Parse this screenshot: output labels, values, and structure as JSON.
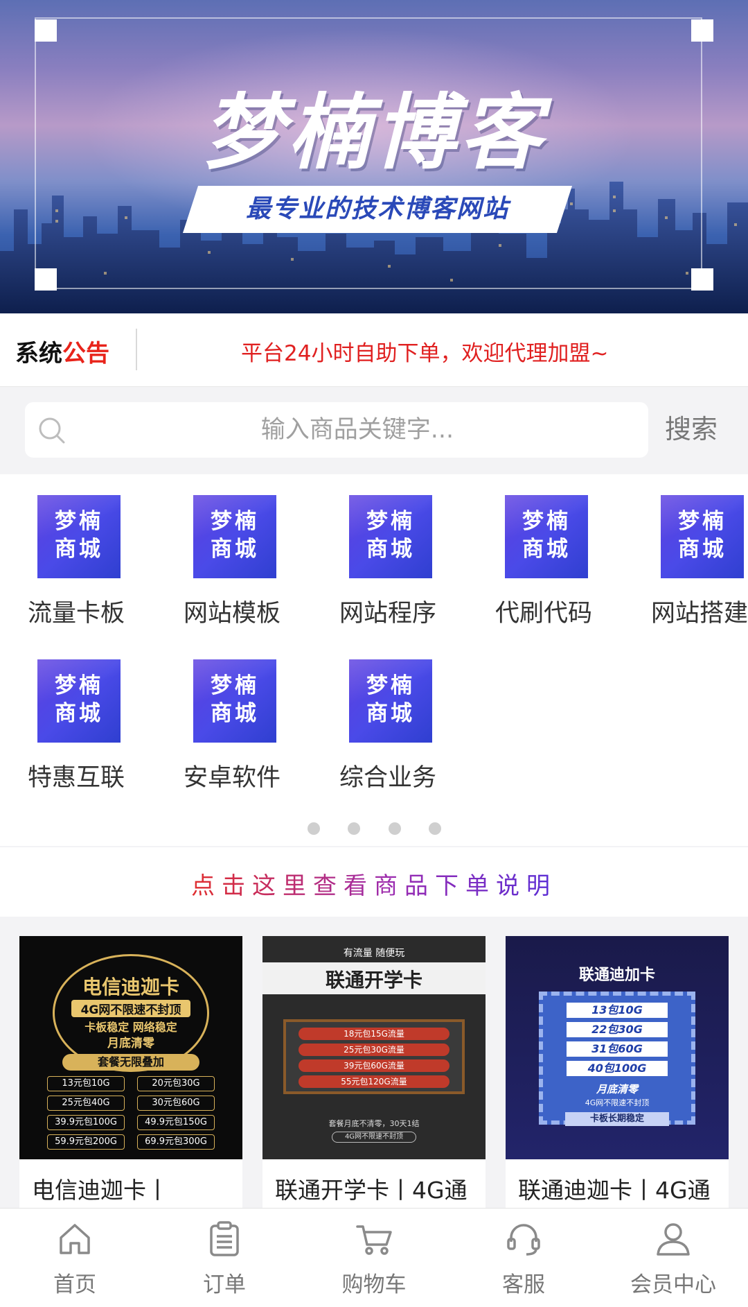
{
  "banner": {
    "title": "梦楠博客",
    "slogan": "最专业的技术博客网站"
  },
  "notice": {
    "label_black": "系统",
    "label_red": "公告",
    "text": "平台24小时自助下单，欢迎代理加盟~"
  },
  "search": {
    "placeholder": "输入商品关键字...",
    "button": "搜索",
    "icon": "search-icon"
  },
  "categories": {
    "tile_line1": "梦楠",
    "tile_line2": "商城",
    "items": [
      {
        "name": "流量卡板"
      },
      {
        "name": "网站模板"
      },
      {
        "name": "网站程序"
      },
      {
        "name": "代刷代码"
      },
      {
        "name": "网站搭建"
      },
      {
        "name": "特惠互联"
      },
      {
        "name": "安卓软件"
      },
      {
        "name": "综合业务"
      }
    ],
    "pages": 4
  },
  "howto": "点击这里查看商品下单说明",
  "products": [
    {
      "title": "电信迪迦卡丨",
      "poster": {
        "name": "电信迪迦卡",
        "sub": "4G网不限速不封顶",
        "tag1": "卡板稳定 网络稳定",
        "tag2": "月底清零",
        "badge": "套餐无限叠加",
        "cells": [
          "13元包10G",
          "20元包30G",
          "25元包40G",
          "30元包60G",
          "39.9元包100G",
          "49.9元包150G",
          "59.9元包200G",
          "69.9元包300G"
        ]
      }
    },
    {
      "title": "联通开学卡丨4G通",
      "poster": {
        "top": "有流量 随便玩",
        "name": "联通开学卡",
        "rows": [
          "18元包15G流量",
          "25元包30G流量",
          "39元包60G流量",
          "55元包120G流量"
        ],
        "foot1": "套餐月底不清零，30天1结",
        "foot2": "4G网不限速不封顶"
      }
    },
    {
      "title": "联通迪迦卡丨4G通",
      "poster": {
        "name": "联通迪加卡",
        "items": [
          "13包10G",
          "22包30G",
          "31包60G",
          "40包100G"
        ],
        "tag1": "月底清零",
        "tag2": "4G网不限速不封顶",
        "foot": "卡板长期稳定"
      }
    }
  ],
  "tabbar": [
    {
      "label": "首页",
      "icon": "home-icon"
    },
    {
      "label": "订单",
      "icon": "clipboard-icon"
    },
    {
      "label": "购物车",
      "icon": "cart-icon"
    },
    {
      "label": "客服",
      "icon": "headset-icon"
    },
    {
      "label": "会员中心",
      "icon": "user-icon"
    }
  ]
}
